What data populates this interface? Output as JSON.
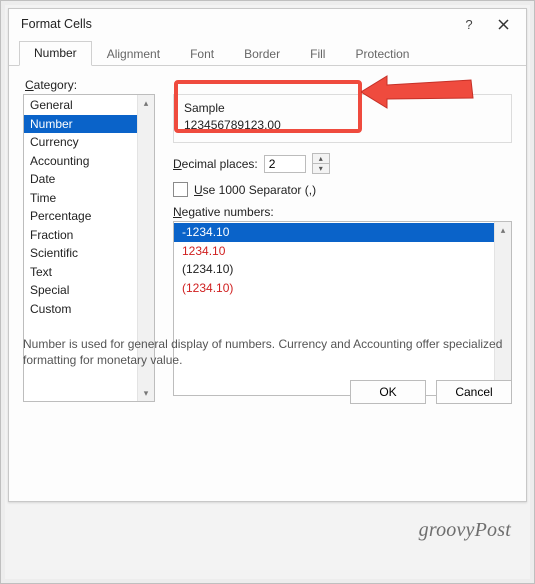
{
  "dialog": {
    "title": "Format Cells",
    "help_glyph": "?",
    "tabs": [
      "Number",
      "Alignment",
      "Font",
      "Border",
      "Fill",
      "Protection"
    ],
    "active_tab": 0,
    "category_label": "Category:",
    "categories": [
      "General",
      "Number",
      "Currency",
      "Accounting",
      "Date",
      "Time",
      "Percentage",
      "Fraction",
      "Scientific",
      "Text",
      "Special",
      "Custom"
    ],
    "selected_category": 1,
    "sample": {
      "label": "Sample",
      "value": "123456789123.00"
    },
    "decimal": {
      "label": "Decimal places:",
      "value": "2"
    },
    "separator": {
      "checked": false,
      "label": "Use 1000 Separator (,)"
    },
    "negative": {
      "label": "Negative numbers:",
      "items": [
        {
          "text": "-1234.10",
          "red": false,
          "selected": true
        },
        {
          "text": "1234.10",
          "red": true,
          "selected": false
        },
        {
          "text": "(1234.10)",
          "red": false,
          "selected": false
        },
        {
          "text": "(1234.10)",
          "red": true,
          "selected": false
        }
      ]
    },
    "description": "Number is used for general display of numbers.  Currency and Accounting offer specialized formatting for monetary value.",
    "buttons": {
      "ok": "OK",
      "cancel": "Cancel"
    }
  },
  "watermark": "groovyPost"
}
